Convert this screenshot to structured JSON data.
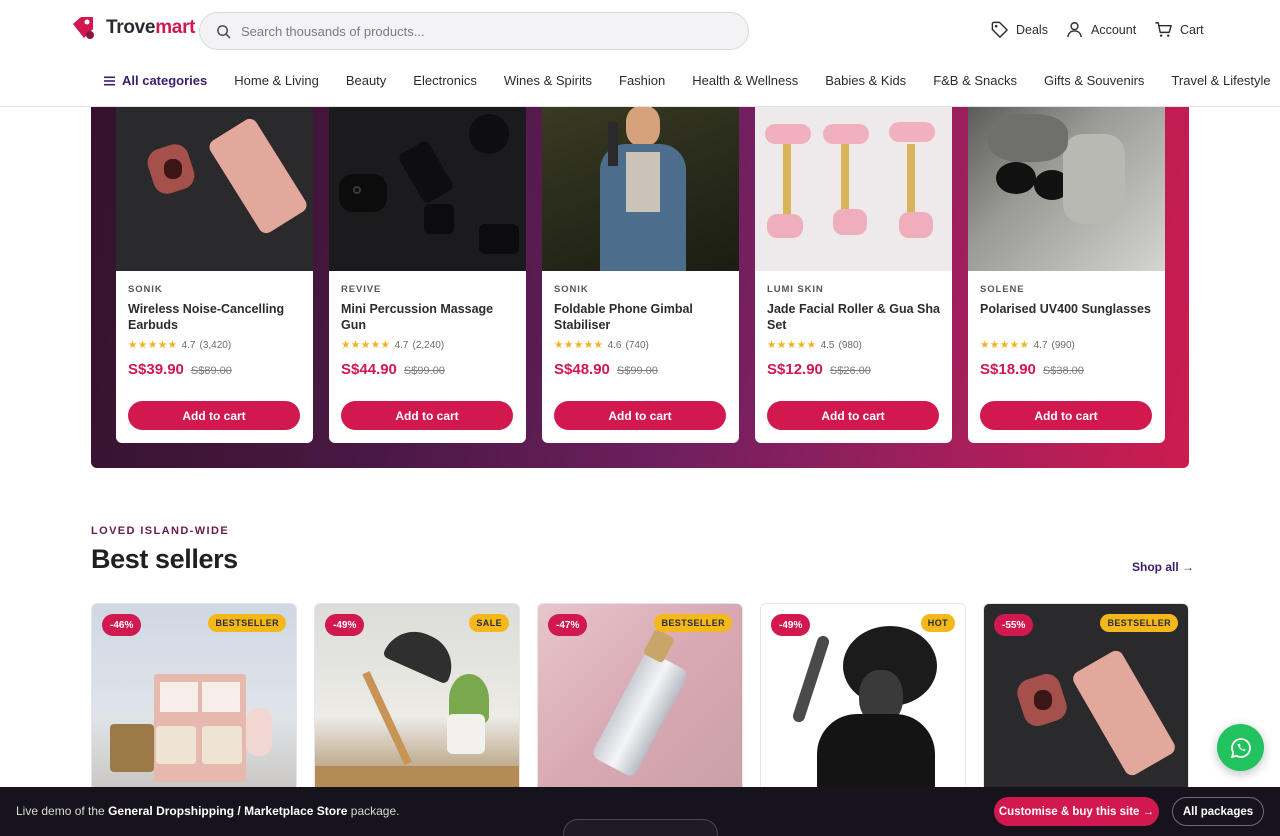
{
  "header": {
    "logo_text_a": "Trove",
    "logo_text_b": "mart",
    "search_placeholder": "Search thousands of products...",
    "deals_label": "Deals",
    "account_label": "Account",
    "cart_label": "Cart"
  },
  "categories": {
    "all_label": "All categories",
    "items": [
      "Home & Living",
      "Beauty",
      "Electronics",
      "Wines & Spirits",
      "Fashion",
      "Health & Wellness",
      "Babies & Kids",
      "F&B & Snacks",
      "Gifts & Souvenirs",
      "Travel & Lifestyle"
    ]
  },
  "promo_products": [
    {
      "brand": "SONIK",
      "name": "Wireless Noise-Cancelling Earbuds",
      "rating": "4.7",
      "reviews": "(3,420)",
      "price": "S$39.90",
      "old_price": "S$89.00",
      "button": "Add to cart"
    },
    {
      "brand": "REVIVE",
      "name": "Mini Percussion Massage Gun",
      "rating": "4.7",
      "reviews": "(2,240)",
      "price": "S$44.90",
      "old_price": "S$99.00",
      "button": "Add to cart"
    },
    {
      "brand": "SONIK",
      "name": "Foldable Phone Gimbal Stabiliser",
      "rating": "4.6",
      "reviews": "(740)",
      "price": "S$48.90",
      "old_price": "S$99.00",
      "button": "Add to cart"
    },
    {
      "brand": "LUMI SKIN",
      "name": "Jade Facial Roller & Gua Sha Set",
      "rating": "4.5",
      "reviews": "(980)",
      "price": "S$12.90",
      "old_price": "S$26.00",
      "button": "Add to cart"
    },
    {
      "brand": "SOLENE",
      "name": "Polarised UV400 Sunglasses",
      "rating": "4.7",
      "reviews": "(990)",
      "price": "S$18.90",
      "old_price": "S$38.00",
      "button": "Add to cart"
    }
  ],
  "stars": "★★★★★",
  "bestsellers": {
    "eyebrow": "LOVED ISLAND-WIDE",
    "title": "Best sellers",
    "shop_all": "Shop all →",
    "items": [
      {
        "discount": "-46%",
        "badge": "BESTSELLER"
      },
      {
        "discount": "-49%",
        "badge": "SALE"
      },
      {
        "discount": "-47%",
        "badge": "BESTSELLER"
      },
      {
        "discount": "-49%",
        "badge": "HOT"
      },
      {
        "discount": "-55%",
        "badge": "BESTSELLER"
      }
    ]
  },
  "bottom_bar": {
    "text_prefix": "Live demo of the ",
    "text_bold": "General Dropshipping / Marketplace Store",
    "text_suffix": " package.",
    "buy_label": "Customise & buy this site →",
    "all_label": "All packages"
  },
  "colors": {
    "accent": "#d1184f",
    "brand_purple": "#3b1d6e",
    "star": "#f2b21b",
    "badge": "#f5b81b",
    "whatsapp": "#22c25e"
  },
  "icons": [
    "search-icon",
    "tag-icon",
    "user-icon",
    "cart-icon",
    "menu-icon",
    "whatsapp-icon"
  ]
}
